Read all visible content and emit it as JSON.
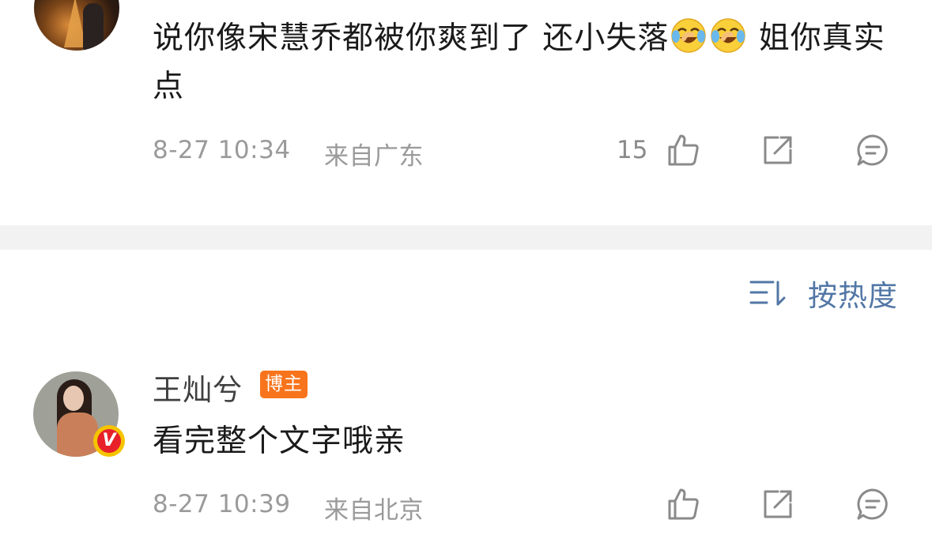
{
  "comments": [
    {
      "text_part1": "说你像宋慧乔都被你爽到了 还小失落",
      "emojis": [
        "laughing-crying-emoji",
        "laughing-crying-emoji"
      ],
      "text_part2": " 姐你真实点",
      "time": "8-27 10:34",
      "location": "来自广东",
      "like_count": "15"
    },
    {
      "username": "王灿兮",
      "author_badge": "博主",
      "verified_badge": "V",
      "text": "看完整个文字哦亲",
      "time": "8-27 10:39",
      "location": "来自北京"
    }
  ],
  "sort": {
    "label": "按热度",
    "icon": "sort-icon"
  },
  "colors": {
    "link_blue": "#5277a6",
    "meta_gray": "#9a9a9a",
    "author_badge_orange": "#f8741c",
    "verified_red": "#e8202a",
    "verified_ring": "#f5c400",
    "divider": "#f2f2f2"
  }
}
